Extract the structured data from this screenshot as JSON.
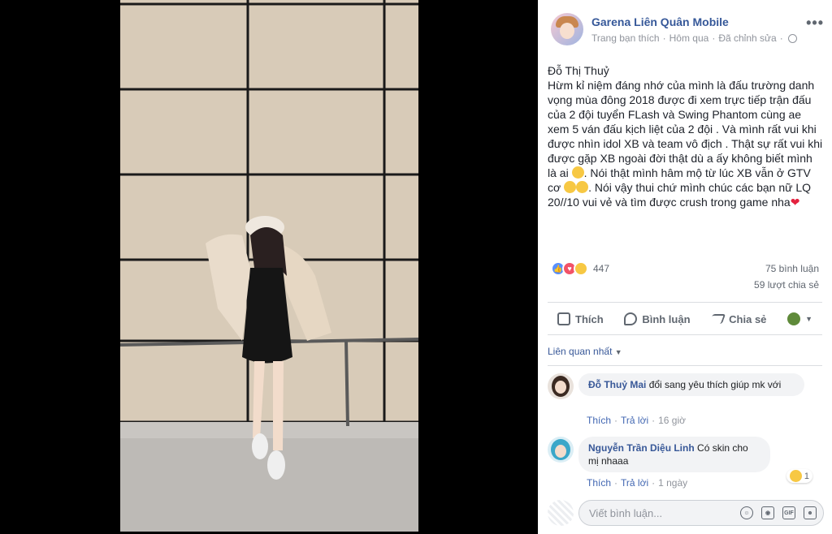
{
  "post": {
    "page_name": "Garena Liên Quân Mobile",
    "meta_liked": "Trang bạn thích",
    "meta_time": "Hôm qua",
    "meta_edited": "Đã chỉnh sửa",
    "more": "•••",
    "text": "Đỗ Thị Thuỷ\nHừm kỉ niệm đáng nhớ của mình là đấu trường danh vọng mùa đông 2018 được đi xem trực tiếp trận đấu của 2 đội tuyển FLash và Swing Phantom cùng ae xem 5 ván đấu kịch liệt của 2 đội . Và mình rất vui khi được nhìn idol XB và team vô địch . Thật sự rất vui khi được gặp XB ngoài đời thật dù a ấy không biết mình là ai",
    "text_part2": ". Nói thật mình hâm mộ từ lúc XB vẫn ở GTV cơ",
    "text_part3": ". Nói vậy thui chứ mình chúc các bạn nữ LQ 20//10 vui vẻ và tìm được crush trong game nha",
    "heart": "❤"
  },
  "stats": {
    "reactions": "447",
    "comments": "75 bình luận",
    "shares": "59 lượt chia sẻ"
  },
  "actions": {
    "like": "Thích",
    "comment": "Bình luận",
    "share": "Chia sẻ"
  },
  "sort": {
    "label": "Liên quan nhất"
  },
  "comments": [
    {
      "author": "Đỗ Thuỷ Mai",
      "text": "đổi sang yêu thích giúp mk với",
      "like": "Thích",
      "reply": "Trả lời",
      "time": "16 giờ"
    },
    {
      "author": "Nguyễn Trần Diệu Linh",
      "text": "Có skin cho mị nhaaa",
      "like": "Thích",
      "reply": "Trả lời",
      "time": "1 ngày",
      "reaction_count": "1"
    }
  ],
  "composer": {
    "placeholder": "Viết bình luận..."
  },
  "colors": {
    "link": "#365899",
    "like_react": "#5890ff",
    "love_react": "#f25268"
  }
}
